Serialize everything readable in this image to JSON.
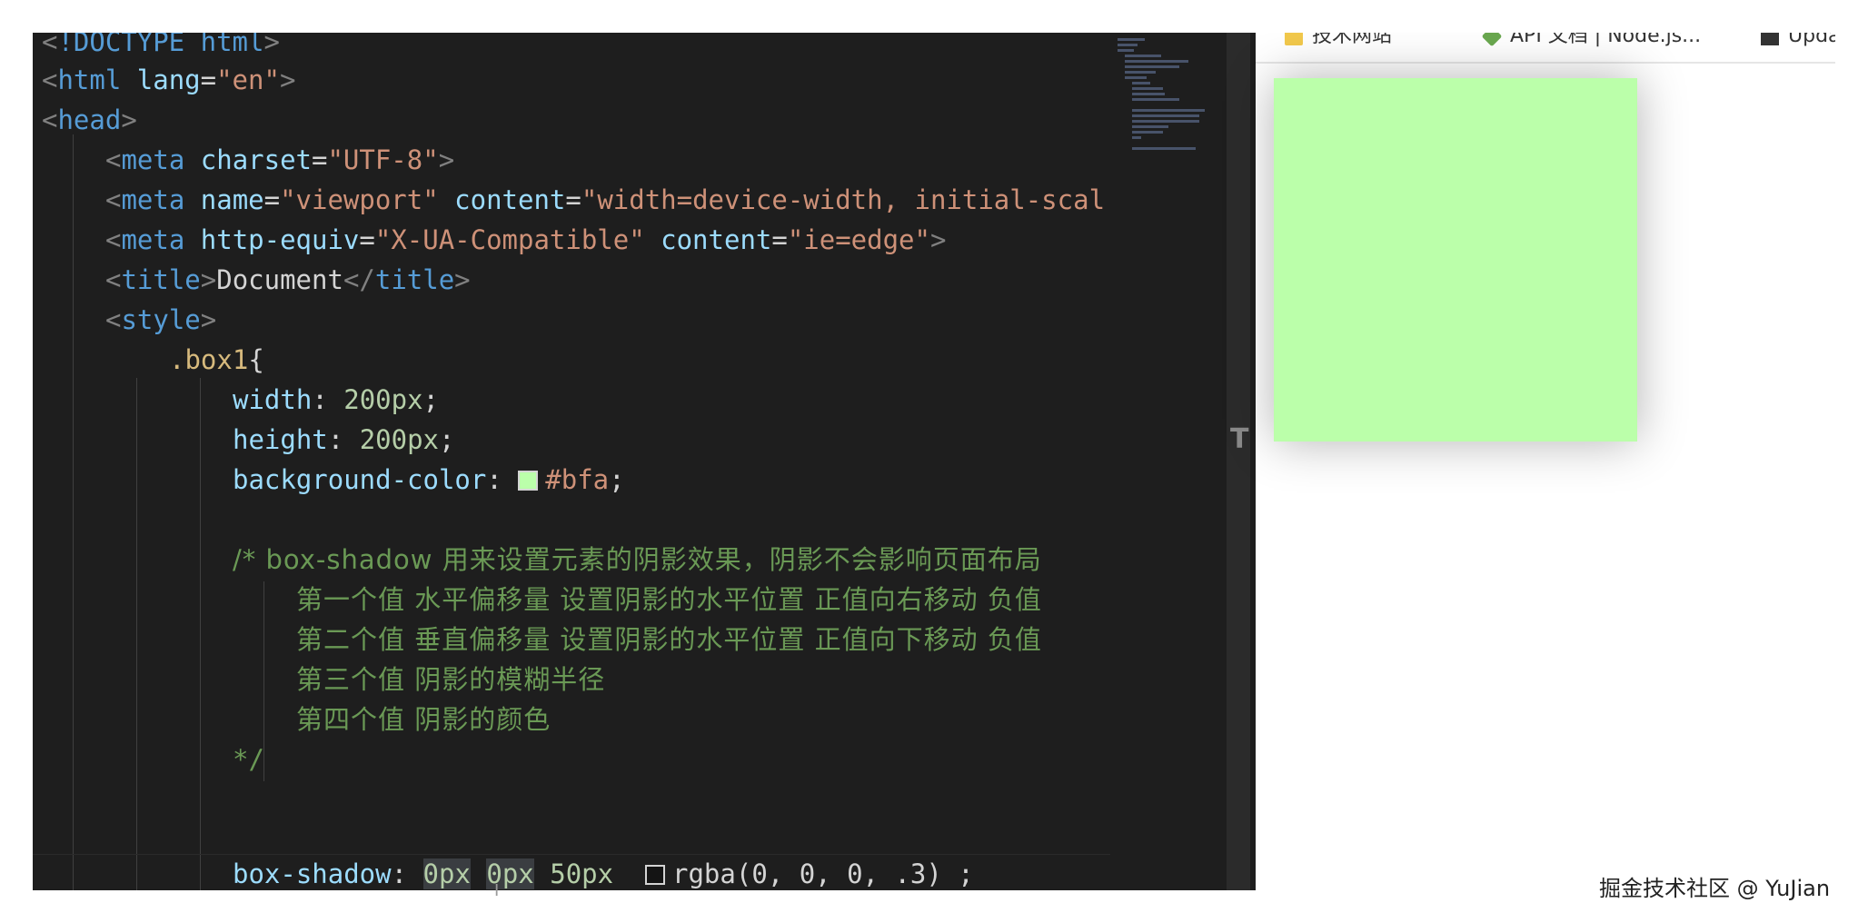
{
  "editor": {
    "lines": {
      "l0": {
        "lt": "<",
        "bang": "!DOCTYPE",
        "sp": " ",
        "kw": "html",
        "gt": ">"
      },
      "l1": {
        "lt": "<",
        "tag": "html",
        "sp": " ",
        "attr": "lang",
        "eq": "=",
        "val": "\"en\"",
        "gt": ">"
      },
      "l2": {
        "lt": "<",
        "tag": "head",
        "gt": ">"
      },
      "l3": {
        "lt": "<",
        "tag": "meta",
        "sp": " ",
        "attr": "charset",
        "eq": "=",
        "val": "\"UTF-8\"",
        "gt": ">"
      },
      "l4": {
        "lt": "<",
        "tag": "meta",
        "sp": " ",
        "attr1": "name",
        "eq1": "=",
        "val1": "\"viewport\"",
        "sp2": " ",
        "attr2": "content",
        "eq2": "=",
        "val2": "\"width=device-width, initial-scal"
      },
      "l5": {
        "lt": "<",
        "tag": "meta",
        "sp": " ",
        "attr1": "http-equiv",
        "eq1": "=",
        "val1": "\"X-UA-Compatible\"",
        "sp2": " ",
        "attr2": "content",
        "eq2": "=",
        "val2": "\"ie=edge\"",
        "gt": ">"
      },
      "l6": {
        "lt": "<",
        "tag": "title",
        "gt": ">",
        "text": "Document",
        "lt2": "</",
        "tag2": "title",
        "gt2": ">"
      },
      "l7": {
        "lt": "<",
        "tag": "style",
        "gt": ">"
      },
      "l8": {
        "sel": ".box1",
        "brace": "{"
      },
      "l9": {
        "prop": "width",
        "colon": ": ",
        "val": "200px",
        "semi": ";"
      },
      "l10": {
        "prop": "height",
        "colon": ": ",
        "val": "200px",
        "semi": ";"
      },
      "l11": {
        "prop": "background-color",
        "colon": ": ",
        "val": "#bfa",
        "semi": ";"
      },
      "l13": {
        "text": "/* box-shadow 用来设置元素的阴影效果，阴影不会影响页面布局"
      },
      "l14": {
        "text": "第一个值 水平偏移量 设置阴影的水平位置 正值向右移动 负值"
      },
      "l15": {
        "text": "第二个值 垂直偏移量 设置阴影的水平位置 正值向下移动 负值"
      },
      "l16": {
        "text": "第三个值 阴影的模糊半径"
      },
      "l17": {
        "text": "第四个值 阴影的颜色"
      },
      "l18": {
        "text": "*/"
      },
      "l20": {
        "prop": "box-shadow",
        "colon": ": ",
        "v1": "0px",
        "v2": "0px",
        "v3": "50px",
        "v4": "rgba(0, 0, 0, .3)",
        "semi": " ;"
      }
    },
    "swatch_colors": {
      "bfa": "#bbffaa",
      "shadow": "rgba(0,0,0,.3)"
    }
  },
  "browser": {
    "bookmarks": [
      "技术网站",
      "API 文档 | Node.js...",
      "Updat"
    ],
    "bookmark_icons": [
      "folder-icon",
      "nodejs-icon",
      "page-icon"
    ],
    "box_color": "#bbffaa"
  },
  "watermark": "掘金技术社区 @ YuJian"
}
